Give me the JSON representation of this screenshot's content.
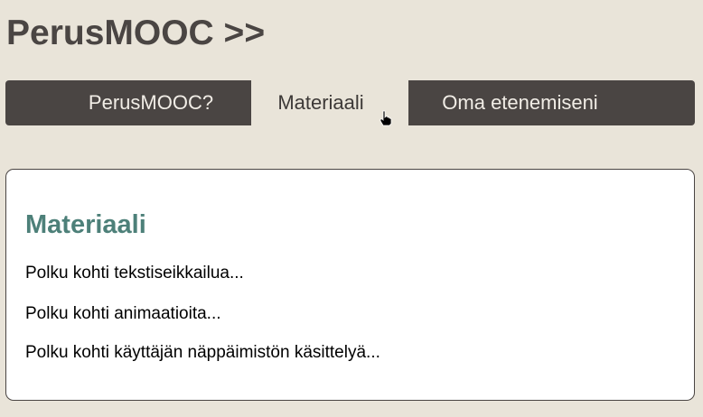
{
  "header": {
    "site_title": "PerusMOOC >>"
  },
  "nav": {
    "tabs": [
      {
        "label": "PerusMOOC?",
        "active": false
      },
      {
        "label": "Materiaali",
        "active": true
      },
      {
        "label": "Oma etenemiseni",
        "active": false
      }
    ]
  },
  "main": {
    "title": "Materiaali",
    "links": [
      "Polku kohti tekstiseikkailua...",
      "Polku kohti animaatioita...",
      "Polku kohti käyttäjän näppäimistön käsittelyä..."
    ]
  },
  "colors": {
    "page_background": "#e9e4d9",
    "tab_dark": "#4a4543",
    "heading_accent": "#4d8079",
    "panel_background": "#ffffff"
  },
  "icons": {
    "cursor": "hand-pointer-icon"
  }
}
